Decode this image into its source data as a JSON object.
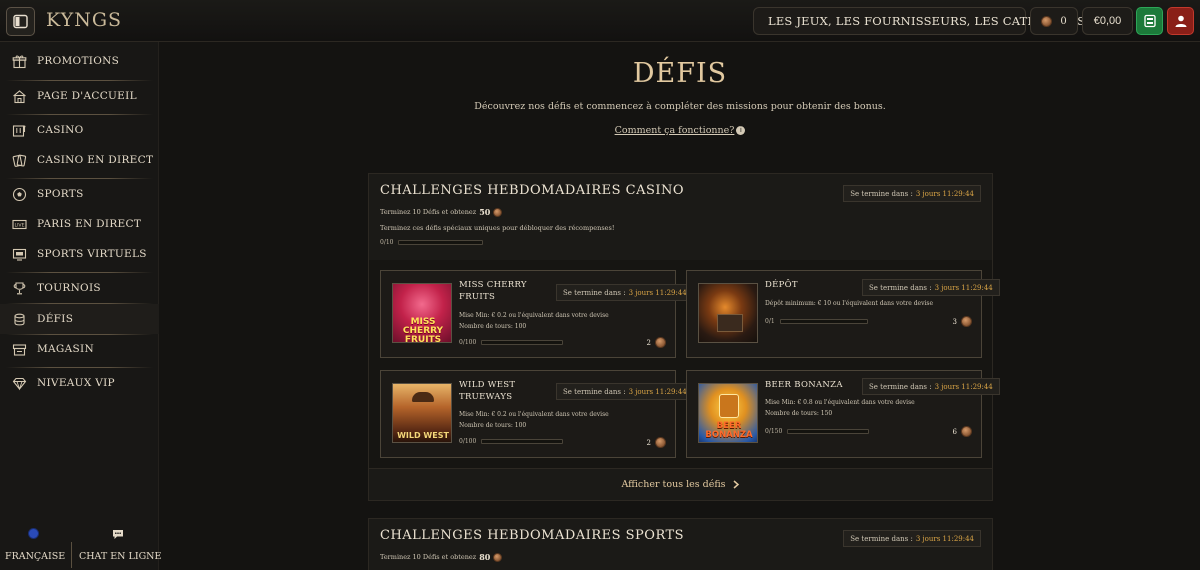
{
  "header": {
    "logo_text": "KYNGS",
    "search_placeholder": "LES JEUX, LES FOURNISSEURS, LES CATÉGORIES",
    "coins": "0",
    "balance": "€0,00"
  },
  "sidebar": {
    "items": [
      {
        "label": "PROMOTIONS",
        "icon": "gift-icon"
      },
      {
        "label": "PAGE D'ACCUEIL",
        "icon": "home-icon"
      },
      {
        "label": "CASINO",
        "icon": "slot-machine-icon"
      },
      {
        "label": "CASINO EN DIRECT",
        "icon": "cards-icon"
      },
      {
        "label": "SPORTS",
        "icon": "soccer-ball-icon"
      },
      {
        "label": "PARIS EN DIRECT",
        "icon": "live-icon"
      },
      {
        "label": "SPORTS VIRTUELS",
        "icon": "monitor-icon"
      },
      {
        "label": "TOURNOIS",
        "icon": "trophy-icon"
      },
      {
        "label": "DÉFIS",
        "icon": "challenge-icon"
      },
      {
        "label": "MAGASIN",
        "icon": "store-icon"
      },
      {
        "label": "NIVEAUX VIP",
        "icon": "diamond-icon"
      }
    ],
    "active": "DÉFIS",
    "footer": {
      "language": "FRANÇAISE",
      "chat": "CHAT EN LIGNE"
    }
  },
  "page": {
    "title": "DÉFIS",
    "subtitle": "Découvrez nos défis et commencez à compléter des missions pour obtenir des bonus.",
    "how_link": "Comment ça fonctionne?"
  },
  "casino_panel": {
    "title": "CHALLENGES HEBDOMADAIRES CASINO",
    "timer_label": "Se termine dans :",
    "timer_value": "3 jours 11:29:44",
    "complete_note": "Terminez 10 Défis et obtenez",
    "reward_amount": "50",
    "unlock_note": "Terminez ces défis spéciaux uniques pour débloquer des récompenses!",
    "progress_text": "0/10",
    "progress": 0,
    "show_all": "Afficher tous les défis",
    "cards": [
      {
        "title": "MISS CHERRY FRUITS",
        "timer_label": "Se termine dans :",
        "timer_value": "3 jours 11:29:44",
        "line1": "Mise Min: € 0.2 ou l'équivalent dans votre devise",
        "line2": "Nombre de tours: 100",
        "progress_text": "0/100",
        "progress": 0,
        "reward": "2",
        "thumb_text": "MISS CHERRY FRUITS"
      },
      {
        "title": "DÉPÔT",
        "timer_label": "Se termine dans :",
        "timer_value": "3 jours 11:29:44",
        "line1": "Dépôt minimum: € 10 ou l'équivalent dans votre devise",
        "line2": "",
        "progress_text": "0/1",
        "progress": 0,
        "reward": "3",
        "thumb_text": ""
      },
      {
        "title": "WILD WEST TRUEWAYS",
        "timer_label": "Se termine dans :",
        "timer_value": "3 jours 11:29:44",
        "line1": "Mise Min: € 0.2 ou l'équivalent dans votre devise",
        "line2": "Nombre de tours: 100",
        "progress_text": "0/100",
        "progress": 0,
        "reward": "2",
        "thumb_text": "WILD WEST"
      },
      {
        "title": "BEER BONANZA",
        "timer_label": "Se termine dans :",
        "timer_value": "3 jours 11:29:44",
        "line1": "Mise Min: € 0.8 ou l'équivalent dans votre devise",
        "line2": "Nombre de tours: 150",
        "progress_text": "0/150",
        "progress": 0,
        "reward": "6",
        "thumb_text": "BEER BONANZA"
      }
    ]
  },
  "sports_panel": {
    "title": "CHALLENGES HEBDOMADAIRES SPORTS",
    "timer_label": "Se termine dans :",
    "timer_value": "3 jours 11:29:44",
    "complete_note": "Terminez 10 Défis et obtenez",
    "reward_amount": "80"
  },
  "colors": {
    "accent_gold": "#e2c9a0",
    "timer_gold": "#d9a446",
    "deposit_green": "#1c7a3a",
    "profile_red": "#8a1f18"
  }
}
